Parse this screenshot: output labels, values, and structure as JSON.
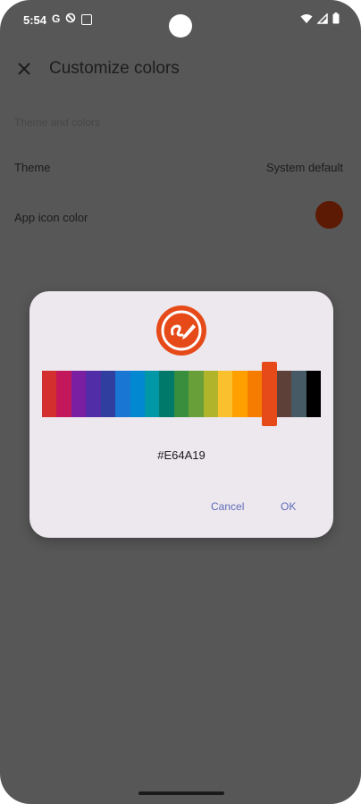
{
  "status_bar": {
    "time": "5:54",
    "left_icons": [
      "google-g-icon",
      "do-not-disturb-icon",
      "notification-box-icon"
    ],
    "right_icons": [
      "wifi-icon",
      "signal-icon",
      "battery-icon"
    ]
  },
  "app_bar": {
    "title": "Customize colors",
    "close_icon": "close-icon"
  },
  "settings": {
    "section_header": "Theme and colors",
    "theme_label": "Theme",
    "theme_value": "System default",
    "app_icon_color_label": "App icon color",
    "app_icon_color_swatch": "#5c1a04"
  },
  "dialog": {
    "icon": "app-logo-icon",
    "icon_color": "#e64a19",
    "palette": [
      "#d32f2f",
      "#c2185b",
      "#7b1fa2",
      "#512da8",
      "#303f9f",
      "#1976d2",
      "#0288d1",
      "#0097a7",
      "#00796b",
      "#388e3c",
      "#689f38",
      "#afb42b",
      "#fbc02d",
      "#ffa000",
      "#f57c00",
      "#e64a19",
      "#5d4037",
      "#455a64",
      "#000000"
    ],
    "selected_index": 15,
    "hex_value": "#E64A19",
    "cancel_label": "Cancel",
    "ok_label": "OK"
  }
}
